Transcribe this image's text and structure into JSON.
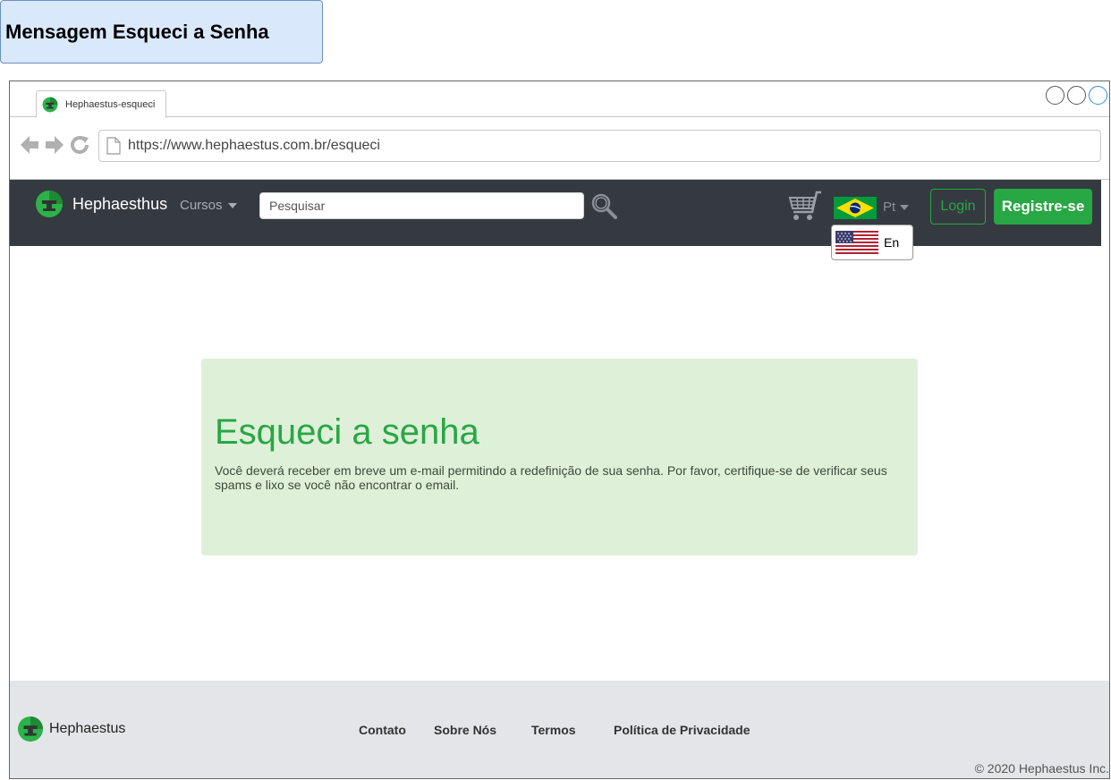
{
  "page_label": "Mensagem Esqueci a Senha",
  "browser": {
    "tab_title": "Hephaestus-esqueci",
    "url": "https://www.hephaestus.com.br/esqueci"
  },
  "navbar": {
    "brand": "Hephaesthus",
    "courses_menu": "Cursos",
    "search_placeholder": "Pesquisar",
    "language": "Pt",
    "login": "Login",
    "register": "Registre-se"
  },
  "language_dropdown": {
    "option": "En"
  },
  "message": {
    "title": "Esqueci a senha",
    "text": "Você deverá receber em breve um e-mail permitindo a redefinição de sua senha. Por favor, certifique-se de verificar seus spams e lixo se você não encontrar o email."
  },
  "footer": {
    "brand": "Hephaestus",
    "links": [
      "Contato",
      "Sobre Nós",
      "Termos",
      "Política de Privacidade"
    ],
    "copyright": "© 2020 Hephaestus Inc."
  },
  "colors": {
    "accent_green": "#28a745",
    "navbar_bg": "#343a40",
    "message_bg": "#dff0d8",
    "footer_bg": "#e4e5e8",
    "label_bg": "#dae8fc"
  },
  "icons": [
    "back-arrow-icon",
    "forward-arrow-icon",
    "reload-icon",
    "page-icon",
    "logo-icon",
    "caret-down-icon",
    "search-icon",
    "cart-icon",
    "brazil-flag-icon",
    "usa-flag-icon"
  ]
}
